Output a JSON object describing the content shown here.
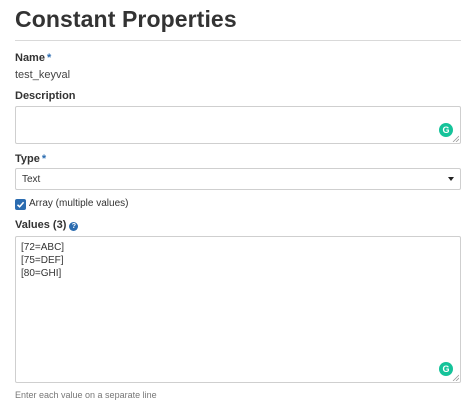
{
  "page": {
    "title": "Constant Properties"
  },
  "name_field": {
    "label": "Name",
    "required_mark": "*",
    "value": "test_keyval"
  },
  "description_field": {
    "label": "Description",
    "value": ""
  },
  "type_field": {
    "label": "Type",
    "required_mark": "*",
    "selected": "Text"
  },
  "array_checkbox": {
    "label": "Array (multiple values)",
    "checked": true
  },
  "values_field": {
    "label": "Values (3)",
    "help_icon": "question-circle-icon",
    "lines": [
      "[72=ABC]",
      "[75=DEF]",
      "[80=GHI]"
    ],
    "hint": "Enter each value on a separate line"
  },
  "colors": {
    "accent": "#2b6cb0",
    "grammarly": "#15c39a"
  }
}
